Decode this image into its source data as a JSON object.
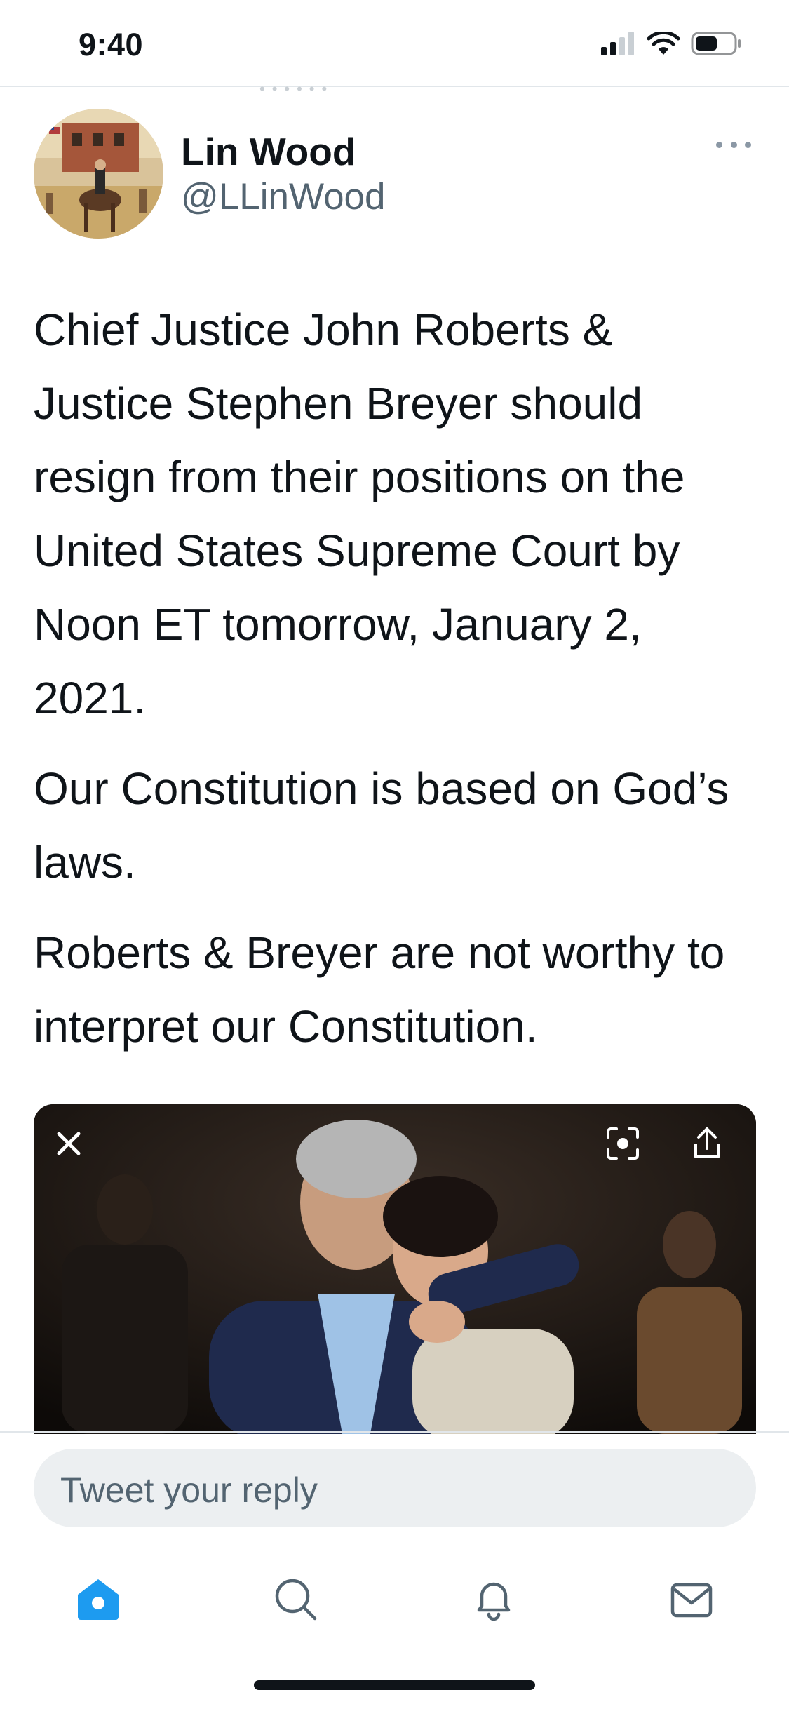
{
  "status_bar": {
    "time": "9:40"
  },
  "tweet": {
    "author": {
      "display_name": "Lin Wood",
      "handle": "@LLinWood"
    },
    "paragraphs": [
      "Chief Justice John Roberts & Justice Stephen Breyer should resign from their positions on the United States Supreme Court by Noon ET tomorrow, January 2, 2021.",
      "Our Constitution is based on God’s laws.",
      "Roberts & Breyer are not worthy to interpret our Constitution."
    ]
  },
  "media": {
    "close_icon": "close-icon",
    "lens_icon": "visual-search-icon",
    "share_icon": "share-icon"
  },
  "reply": {
    "placeholder": "Tweet your reply"
  },
  "tab_bar": {
    "tabs": [
      {
        "icon": "home-icon",
        "active": true
      },
      {
        "icon": "search-icon",
        "active": false
      },
      {
        "icon": "bell-icon",
        "active": false
      },
      {
        "icon": "mail-icon",
        "active": false
      }
    ]
  },
  "colors": {
    "accent": "#1d9bf0",
    "text": "#0f1419",
    "secondary_text": "#536471",
    "reply_bg": "#eceff1"
  }
}
